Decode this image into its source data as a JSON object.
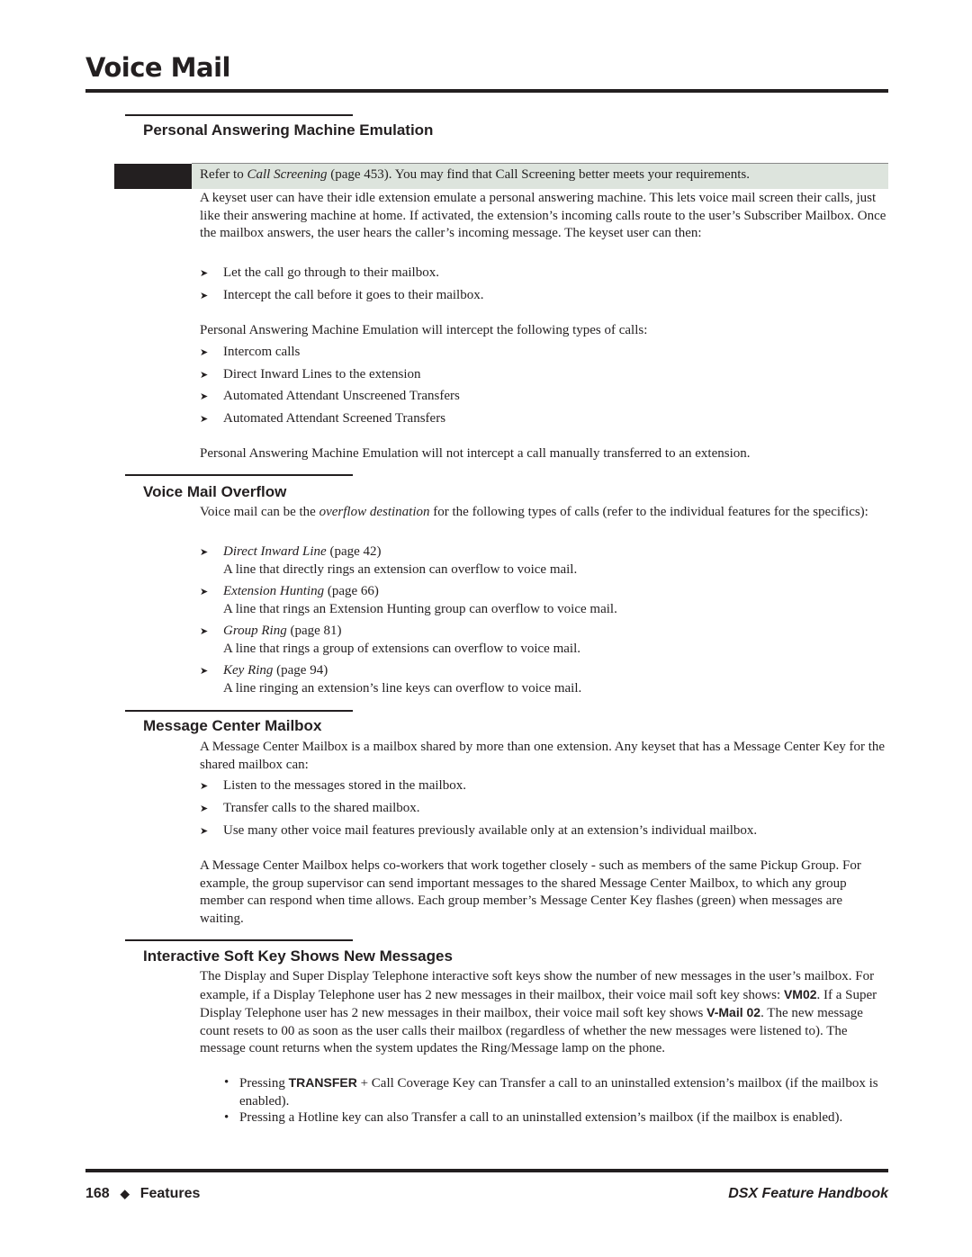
{
  "header": {
    "title": "Voice Mail"
  },
  "sections": {
    "pame": {
      "heading": "Personal Answering Machine Emulation",
      "note": {
        "prefix": "Refer to ",
        "link": "Call Screening",
        "suffix": " (page 453). You may find that Call Screening better meets your requirements."
      },
      "intro": "A keyset user can have their idle extension emulate a personal answering machine. This lets voice mail screen their calls, just like their answering machine at home. If activated, the extension’s incoming calls route to the user’s Subscriber Mailbox. Once the mailbox answers, the user hears the caller’s incoming mes­sage. The keyset user can then:",
      "options": [
        "Let the call go through to their mailbox.",
        "Intercept the call before it goes to their mailbox."
      ],
      "intercept_intro": "Personal Answering Machine Emulation will intercept the following types of calls:",
      "intercept_types": [
        "Intercom calls",
        "Direct Inward Lines to the extension",
        "Automated Attendant Unscreened Transfers",
        "Automated Attendant Screened Transfers"
      ],
      "exclusion": "Personal Answering Machine Emulation will not intercept a call manually transferred to an extension."
    },
    "overflow": {
      "heading": "Voice Mail Overflow",
      "intro_prefix": "Voice mail can be the ",
      "intro_em": "overflow destination",
      "intro_suffix": " for the following types of calls (refer to the individual features for the specifics):",
      "items": [
        {
          "feature": "Direct Inward Line",
          "page": " (page 42)",
          "desc": "A line that directly rings an extension can overflow to voice mail."
        },
        {
          "feature": "Extension Hunting",
          "page": " (page 66)",
          "desc": "A line that rings an Extension Hunting group can overflow to voice mail."
        },
        {
          "feature": "Group Ring",
          "page": " (page 81)",
          "desc": "A line that rings a group of extensions can overflow to voice mail."
        },
        {
          "feature": "Key Ring",
          "page": " (page 94)",
          "desc": "A line ringing an extension’s line keys can overflow to voice mail."
        }
      ]
    },
    "mcm": {
      "heading": "Message Center Mailbox",
      "intro": "A Message Center Mailbox is a mailbox shared by more than one extension. Any keyset that has a Message Center Key for the shared mailbox can:",
      "items": [
        "Listen to the messages stored in the mailbox.",
        "Transfer calls to the shared mailbox.",
        "Use many other voice mail features previously available only at an extension’s individual mailbox."
      ],
      "detail": "A Message Center Mailbox helps co-workers that work together closely - such as members of the same Pickup Group. For example, the group supervisor can send important messages to the shared Message Cen­ter Mailbox, to which any group member can respond when time allows. Each group member’s Message Center Key flashes (green) when messages are waiting."
    },
    "softkey": {
      "heading": "Interactive Soft Key Shows New Messages",
      "p1": "The Display and Super Display Telephone interactive soft keys show the number of new messages in the user’s mailbox. For example, if a Display Telephone user has 2 new messages in their mailbox, their voice mail soft key shows: ",
      "code1": "VM02",
      "p2": ". If a Super Display Telephone user has 2 new messages in their mailbox, their voice mail soft key shows ",
      "code2": "V-Mail 02",
      "p3": ". The new message count resets to 00 as soon as the user calls their mail­box (regardless of whether the new messages were listened to). The message count returns when the system updates the Ring/Message lamp on the phone.",
      "bullet1_prefix": "Pressing ",
      "bullet1_key": "TRANSFER",
      "bullet1_suffix": " + Call Coverage Key can Transfer a call to an uninstalled extension’s mailbox (if the mailbox is enabled).",
      "bullet2": "Pressing a Hotline key can also Transfer a call to an uninstalled extension’s mailbox (if the mailbox is enabled)."
    }
  },
  "footer": {
    "page_number": "168",
    "section": "Features",
    "book_title": "DSX Feature Handbook"
  }
}
